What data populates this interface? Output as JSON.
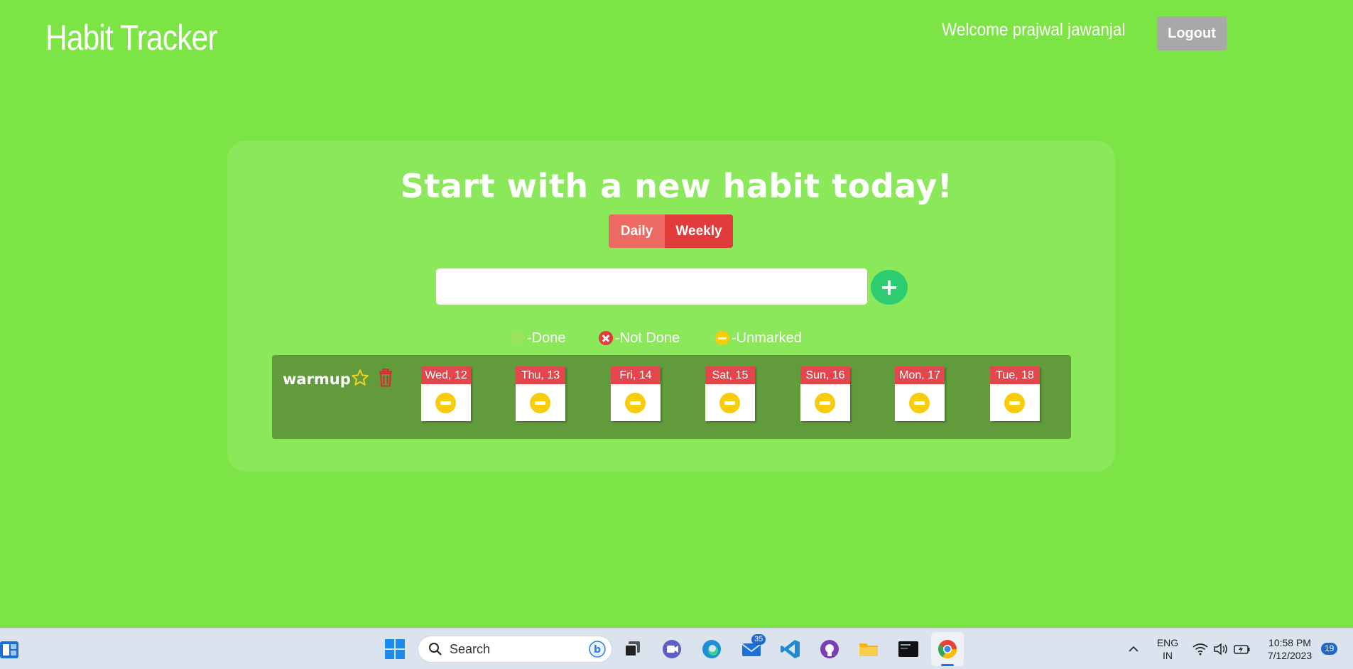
{
  "header": {
    "app_title": "Habit Tracker",
    "welcome_text": "Welcome prajwal jawanjal",
    "logout_label": "Logout"
  },
  "main": {
    "headline": "Start with a new habit today!",
    "toggle": {
      "daily_label": "Daily",
      "weekly_label": "Weekly",
      "active": "Weekly"
    },
    "habit_input": {
      "value": "",
      "placeholder": ""
    },
    "add_button_label": "+",
    "legend": [
      {
        "icon": "done-icon",
        "label": "-Done"
      },
      {
        "icon": "not-done-icon",
        "label": "-Not Done"
      },
      {
        "icon": "unmarked-icon",
        "label": "-Unmarked"
      }
    ],
    "habits": [
      {
        "name": "warmup",
        "favorite": false,
        "days": [
          {
            "label": "Wed, 12",
            "status": "unmarked"
          },
          {
            "label": "Thu, 13",
            "status": "unmarked"
          },
          {
            "label": "Fri, 14",
            "status": "unmarked"
          },
          {
            "label": "Sat, 15",
            "status": "unmarked"
          },
          {
            "label": "Sun, 16",
            "status": "unmarked"
          },
          {
            "label": "Mon, 17",
            "status": "unmarked"
          },
          {
            "label": "Tue, 18",
            "status": "unmarked"
          }
        ]
      }
    ]
  },
  "taskbar": {
    "search_label": "Search",
    "mail_badge": "35",
    "language": "ENG",
    "region": "IN",
    "time": "10:58 PM",
    "date": "7/12/2023",
    "notification_count": "19"
  },
  "colors": {
    "background": "#7de445",
    "card": "#8ae85a",
    "habit_row": "#619b3b",
    "accent_red": "#e23b3b",
    "add_green": "#2ecc71",
    "unmarked_yellow": "#f6cc0b"
  }
}
